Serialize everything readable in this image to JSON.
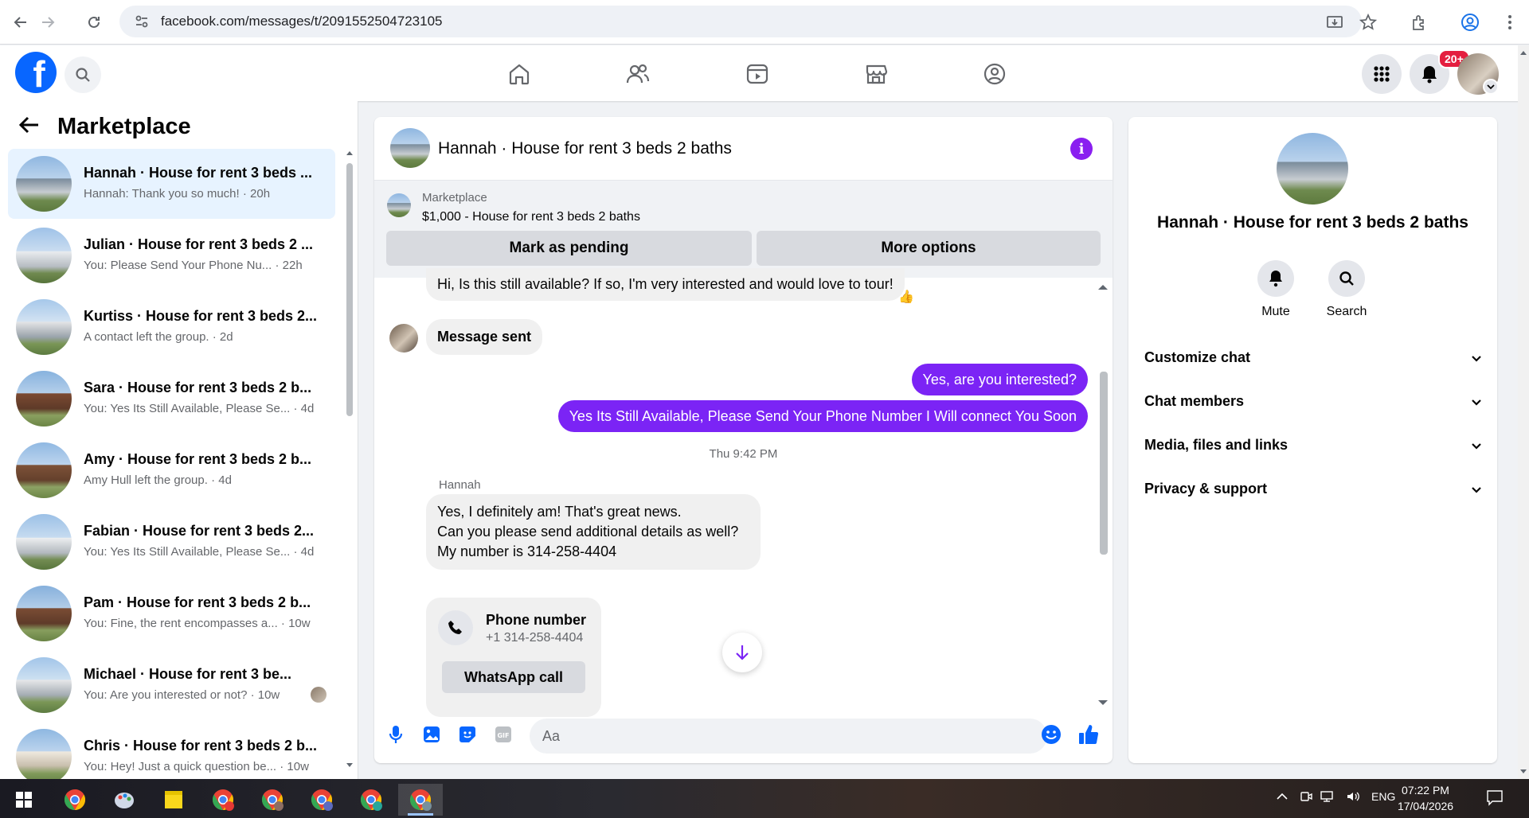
{
  "browser": {
    "url": "facebook.com/messages/t/2091552504723105"
  },
  "fbnav": {
    "logo": "f",
    "notification_badge": "20+"
  },
  "sidebar": {
    "title": "Marketplace",
    "conversations": [
      {
        "name": "Hannah · House for rent 3 beds ...",
        "preview": "Hannah: Thank you so much! · 20h",
        "active": true
      },
      {
        "name": "Julian · House for rent 3 beds 2 ...",
        "preview": "You: Please Send Your Phone Nu... · 22h"
      },
      {
        "name": "Kurtiss · House for rent 3 beds 2...",
        "preview": "A contact left the group. · 2d"
      },
      {
        "name": "Sara · House for rent 3 beds 2 b...",
        "preview": "You: Yes Its Still Available, Please Se... · 4d"
      },
      {
        "name": "Amy · House for rent 3 beds 2 b...",
        "preview": "Amy Hull left the group. · 4d"
      },
      {
        "name": "Fabian · House for rent 3 beds 2...",
        "preview": "You: Yes Its Still Available, Please Se... · 4d"
      },
      {
        "name": "Pam · House for rent 3 beds 2 b...",
        "preview": "You: Fine, the rent encompasses a... · 10w"
      },
      {
        "name": "Michael · House for rent 3 be...",
        "preview": "You: Are you interested or not? · 10w"
      },
      {
        "name": "Chris · House for rent 3 beds 2 b...",
        "preview": "You: Hey! Just a quick question be... · 10w"
      }
    ]
  },
  "chat": {
    "title": "Hannah · House for rent 3 beds 2 baths",
    "marketplace_label": "Marketplace",
    "listing": "$1,000 - House for rent 3 beds 2 baths",
    "btn_pending": "Mark as pending",
    "btn_more": "More options",
    "messages": {
      "m1": "Hi, Is this still available? If so, I'm very interested and would love to tour!",
      "m1_reaction": "👍",
      "m2": "Message sent",
      "m3": "Yes, are you interested?",
      "m4": "Yes Its Still Available, Please Send Your Phone Number I Will connect You Soon",
      "timestamp": "Thu 9:42 PM",
      "sender": "Hannah",
      "m5_l1": "Yes, I definitely am! That's great news.",
      "m5_l2": "Can you please send additional details as well?",
      "m5_l3": "My number is 314-258-4404",
      "phone_title": "Phone number",
      "phone_number": "+1 314-258-4404",
      "whatsapp": "WhatsApp call"
    },
    "input_placeholder": "Aa"
  },
  "right_panel": {
    "title": "Hannah · House for rent 3 beds 2 baths",
    "mute": "Mute",
    "search": "Search",
    "sections": [
      "Customize chat",
      "Chat members",
      "Media, files and links",
      "Privacy & support"
    ]
  },
  "taskbar": {
    "lang": "ENG",
    "time": "07:22 PM",
    "date": "17/04/2026"
  },
  "colors": {
    "accent": "#7b24f5",
    "fb_blue": "#0866ff",
    "badge": "#e41e3f"
  }
}
